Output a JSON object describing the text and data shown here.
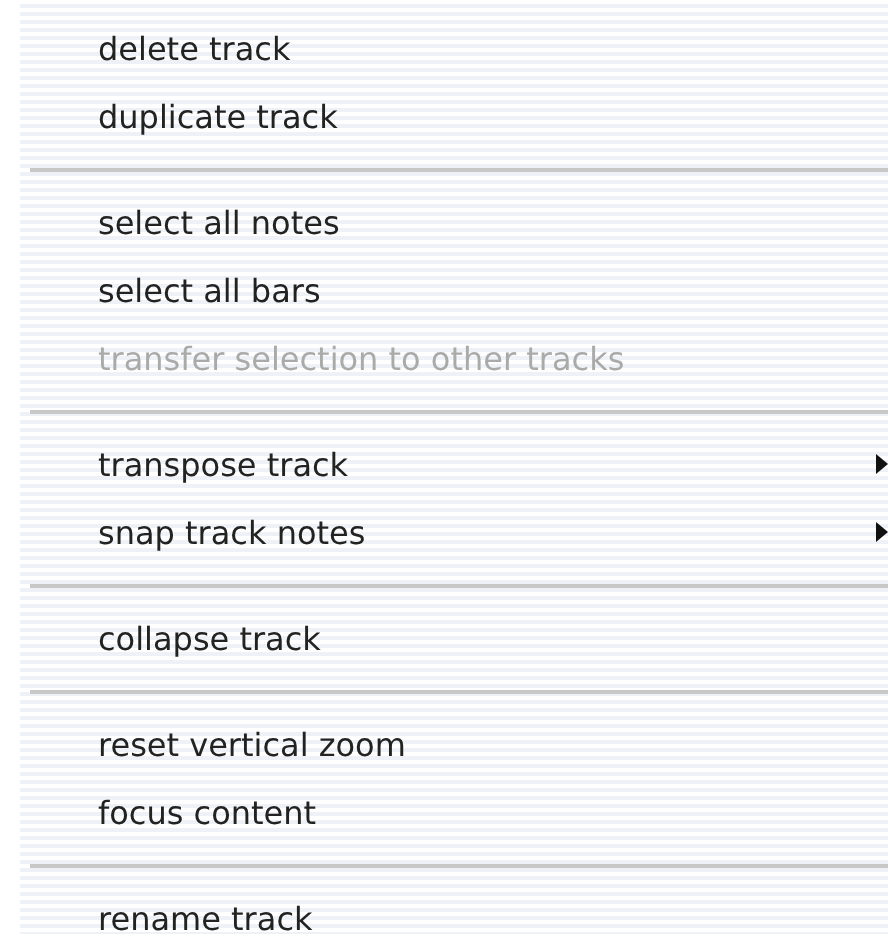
{
  "menu": {
    "groups": [
      {
        "items": [
          {
            "label": "delete track",
            "disabled": false,
            "submenu": false
          },
          {
            "label": "duplicate track",
            "disabled": false,
            "submenu": false
          }
        ]
      },
      {
        "items": [
          {
            "label": "select all notes",
            "disabled": false,
            "submenu": false
          },
          {
            "label": "select all bars",
            "disabled": false,
            "submenu": false
          },
          {
            "label": "transfer selection to other tracks",
            "disabled": true,
            "submenu": false
          }
        ]
      },
      {
        "items": [
          {
            "label": "transpose track",
            "disabled": false,
            "submenu": true
          },
          {
            "label": "snap track notes",
            "disabled": false,
            "submenu": true
          }
        ]
      },
      {
        "items": [
          {
            "label": "collapse track",
            "disabled": false,
            "submenu": false
          }
        ]
      },
      {
        "items": [
          {
            "label": "reset vertical zoom",
            "disabled": false,
            "submenu": false
          },
          {
            "label": "focus content",
            "disabled": false,
            "submenu": false
          }
        ]
      },
      {
        "items": [
          {
            "label": "rename track",
            "disabled": false,
            "submenu": false
          }
        ]
      }
    ]
  }
}
